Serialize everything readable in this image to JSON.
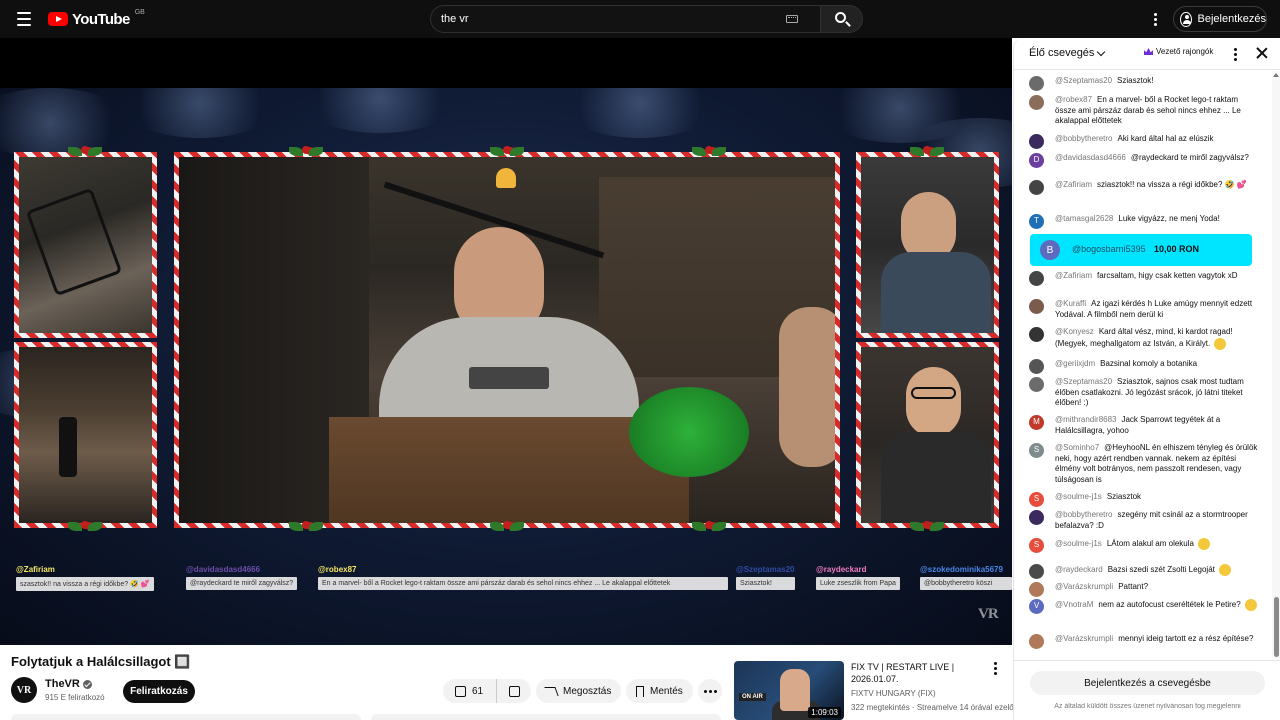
{
  "masthead": {
    "logo_text": "YouTube",
    "logo_country": "GB",
    "search_value": "the vr",
    "signin_label": "Bejelentkezés"
  },
  "overlay_chat": [
    {
      "name": "@Zafiriam",
      "name_color": "#f5e663",
      "msg": "szasztok!! na vissza a régi időkbe? 🤣 💕"
    },
    {
      "name": "@davidasdasd4666",
      "name_color": "#6b4ea8",
      "msg": "@raydeckard te miről zagyválsz?"
    },
    {
      "name": "@robex87",
      "name_color": "#f5e663",
      "msg": "En a marvel- ből a Rocket lego-t raktam össze ami párszáz darab és sehol nincs ehhez ... Le akalappal előttetek"
    },
    {
      "name": "@Szeptamas20",
      "name_color": "#2f4ca8",
      "msg": "Sziasztok!"
    },
    {
      "name": "@raydeckard",
      "name_color": "#f07ac0",
      "msg": "Luke zseszlik from Papa"
    },
    {
      "name": "@szokedominika5679",
      "name_color": "#4a86e8",
      "msg": "@bobbytheretro köszi"
    }
  ],
  "video": {
    "title": "Folytatjuk a Halálcsillagot 🔲",
    "watermark": "VR",
    "channel_avatar": "VR",
    "channel_name": "TheVR",
    "subscribers": "915 E feliratkozó",
    "subscribe_label": "Feliratkozás",
    "likes": "61",
    "share_label": "Megosztás",
    "save_label": "Mentés"
  },
  "recommendation": {
    "title": "FIX TV | RESTART LIVE | 2026.01.07.",
    "channel": "FIXTV HUNGARY (FIX)",
    "meta": "322 megtekintés · Streamelve 14 órával ezelőtt",
    "duration": "1:09:03",
    "badge": "ON AIR"
  },
  "chat": {
    "mode_label": "Élő csevegés",
    "top_fans_label": "Vezető rajongók",
    "messages": [
      {
        "avatar": "",
        "avatar_color": "#6b6b6b",
        "author": "@Szeptamas20",
        "text": "Sziasztok!"
      },
      {
        "avatar": "",
        "avatar_color": "#8a6d5a",
        "author": "@robex87",
        "text": "En a marvel- ből a Rocket lego-t raktam össze ami párszáz darab és sehol nincs ehhez ... Le akalappal előttetek"
      },
      {
        "avatar": "",
        "avatar_color": "#3a2a5e",
        "author": "@bobbytheretro",
        "text": "Aki kard által hal az elúszik"
      },
      {
        "avatar": "D",
        "avatar_color": "#6b3fa0",
        "author": "@davidasdasd4666",
        "text": "@raydeckard te miről zagyválsz?"
      },
      {
        "avatar": "",
        "avatar_color": "#444444",
        "author": "@Zafiriam",
        "text": "sziasztok!! na vissza a régi időkbe? 🤣 💕"
      },
      {
        "avatar": "T",
        "avatar_color": "#1e6fb5",
        "author": "@tamasgal2628",
        "text": "Luke vigyázz, ne menj Yoda!"
      },
      {
        "avatar": "",
        "avatar_color": "#444444",
        "author": "@Zafiriam",
        "text": "farcsaltam, higy csak ketten vagytok xD"
      },
      {
        "avatar": "",
        "avatar_color": "#7a5b4c",
        "author": "@Kuraffi",
        "text": "Az igazi kérdés h Luke amúgy mennyit edzett Yodával. A filmből nem derül ki"
      },
      {
        "avatar": "",
        "avatar_color": "#333333",
        "author": "@Konyesz",
        "text": "Kard által vész, mind, ki kardot ragad! (Megyek, meghallgatom az István, a Királyt."
      },
      {
        "avatar": "",
        "avatar_color": "#555555",
        "author": "@geriixjdm",
        "text": "Bazsinal komoly a botanika"
      },
      {
        "avatar": "",
        "avatar_color": "#6b6b6b",
        "author": "@Szeptamas20",
        "text": "Sziasztok, sajnos csak most tudtam élőben csatlakozni. Jó legózást srácok, jó látni titeket élőben! :)"
      },
      {
        "avatar": "M",
        "avatar_color": "#c0392b",
        "author": "@mithrandir8683",
        "text": "Jack Sparrowt tegyétek át a Halálcsillagra, yohoo"
      },
      {
        "avatar": "S",
        "avatar_color": "#7f8c8d",
        "author": "@Sominho7",
        "text": "@HeyhooNL én elhiszem tényleg és örülök neki, hogy azért rendben vannak. nekem az építési élmény volt botrányos, nem passzolt rendesen, vagy túlságosan is"
      },
      {
        "avatar": "S",
        "avatar_color": "#e74c3c",
        "author": "@soulme-j1s",
        "text": "Sziasztok"
      },
      {
        "avatar": "",
        "avatar_color": "#3a2a5e",
        "author": "@bobbytheretro",
        "text": "szegény mit csinál az a stormtrooper befalazva? :D"
      },
      {
        "avatar": "S",
        "avatar_color": "#e74c3c",
        "author": "@soulme-j1s",
        "text": "LÁtom alakul am olekula"
      },
      {
        "avatar": "",
        "avatar_color": "#4a4a4a",
        "author": "@raydeckard",
        "text": "Bazsi szedi szét Zsolti Legoját"
      },
      {
        "avatar": "",
        "avatar_color": "#b07a5a",
        "author": "@Varázskrumpli",
        "text": "Pattant?"
      },
      {
        "avatar": "V",
        "avatar_color": "#5c6bc0",
        "author": "@VnotraM",
        "text": "nem az autofocust cseréltétek le Petire?"
      },
      {
        "avatar": "",
        "avatar_color": "#b07a5a",
        "author": "@Varázskrumpli",
        "text": "mennyi ideig tartott ez a rész építése?"
      }
    ],
    "superchat": {
      "avatar": "B",
      "author": "@bogosbarni5395",
      "amount": "10,00 RON",
      "color": "#00e5ff"
    },
    "login_label": "Bejelentkezés a csevegésbe",
    "note": "Az általad küldött összes üzenet nyilvánosan fog megjelenni"
  }
}
